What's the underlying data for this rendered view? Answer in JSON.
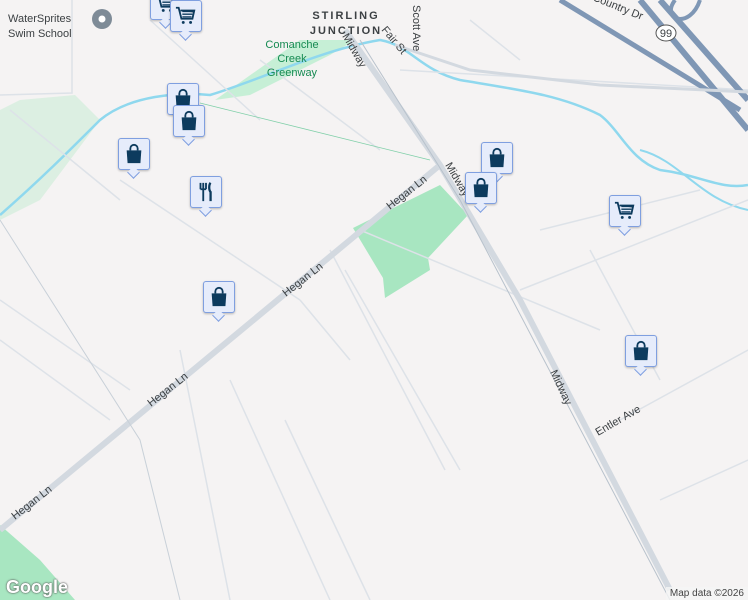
{
  "map": {
    "labels": {
      "poi_swim": [
        "WaterSprites",
        "Swim School"
      ],
      "neighborhood": [
        "STIRLING",
        "JUNCTION"
      ],
      "park": [
        "Comanche",
        "Creek",
        "Greenway"
      ],
      "scott_ave": "Scott Ave",
      "fair_st": "Fair St",
      "country_dr": "Country Dr",
      "hwy": "99",
      "midway": "Midway",
      "hegan_ln": "Hegan Ln",
      "entler_ave": "Entler Ave"
    },
    "markers": [
      {
        "type": "grocery",
        "icon": "shopping-cart-icon"
      },
      {
        "type": "grocery",
        "icon": "shopping-cart-icon"
      },
      {
        "type": "store",
        "icon": "shopping-bag-icon"
      },
      {
        "type": "store",
        "icon": "shopping-bag-icon"
      },
      {
        "type": "store",
        "icon": "shopping-bag-icon"
      },
      {
        "type": "restaurant",
        "icon": "fork-knife-icon"
      },
      {
        "type": "store",
        "icon": "shopping-bag-icon"
      },
      {
        "type": "store",
        "icon": "shopping-bag-icon"
      },
      {
        "type": "store",
        "icon": "shopping-bag-icon"
      },
      {
        "type": "grocery",
        "icon": "shopping-cart-icon"
      },
      {
        "type": "store",
        "icon": "shopping-bag-icon"
      }
    ],
    "colors": {
      "background": "#f5f3f3",
      "park": "#a8e6c1",
      "water": "#8fd8ee",
      "road": "#d3d9e0",
      "highway": "#7f97b5",
      "marker_icon": "#0d3b5e"
    },
    "attribution": "Map data ©2026",
    "logo": "Google"
  }
}
